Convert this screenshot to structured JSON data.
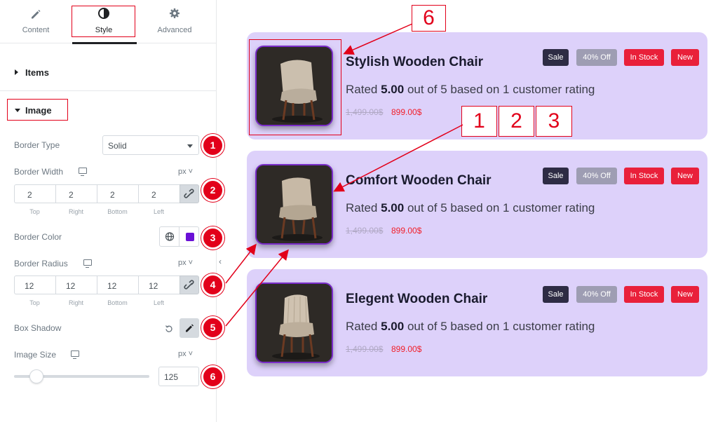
{
  "tabs": [
    {
      "label": "Content",
      "icon": "pencil-icon"
    },
    {
      "label": "Style",
      "icon": "contrast-icon"
    },
    {
      "label": "Advanced",
      "icon": "gear-icon"
    }
  ],
  "sections": {
    "items": "Items",
    "image": "Image"
  },
  "controls": {
    "border_type": {
      "label": "Border Type",
      "value": "Solid"
    },
    "border_width": {
      "label": "Border Width",
      "unit": "px",
      "values": [
        "2",
        "2",
        "2",
        "2"
      ],
      "sides": [
        "Top",
        "Right",
        "Bottom",
        "Left"
      ]
    },
    "border_color": {
      "label": "Border Color",
      "color": "#6a10d6"
    },
    "border_radius": {
      "label": "Border Radius",
      "unit": "px",
      "values": [
        "12",
        "12",
        "12",
        "12"
      ],
      "sides": [
        "Top",
        "Right",
        "Bottom",
        "Left"
      ]
    },
    "box_shadow": {
      "label": "Box Shadow"
    },
    "image_size": {
      "label": "Image Size",
      "unit": "px",
      "value": "125",
      "slider_fraction": 0.12
    }
  },
  "callouts": [
    "1",
    "2",
    "3",
    "4",
    "5",
    "6"
  ],
  "annotations": {
    "top": "6",
    "a": "1",
    "b": "2",
    "c": "3"
  },
  "products": [
    {
      "title": "Stylish Wooden Chair",
      "rating_prefix": "Rated",
      "rating_value": "5.00",
      "rating_suffix": "out of 5 based on 1 customer rating",
      "old_price": "1,499.00$",
      "new_price": "899.00$",
      "tags": [
        "Sale",
        "40% Off",
        "In Stock",
        "New"
      ]
    },
    {
      "title": "Comfort Wooden Chair",
      "rating_prefix": "Rated",
      "rating_value": "5.00",
      "rating_suffix": "out of 5 based on 1 customer rating",
      "old_price": "1,499.00$",
      "new_price": "899.00$",
      "tags": [
        "Sale",
        "40% Off",
        "In Stock",
        "New"
      ]
    },
    {
      "title": "Elegent Wooden Chair",
      "rating_prefix": "Rated",
      "rating_value": "5.00",
      "rating_suffix": "out of 5 based on 1 customer rating",
      "old_price": "1,499.00$",
      "new_price": "899.00$",
      "tags": [
        "Sale",
        "40% Off",
        "In Stock",
        "New"
      ]
    }
  ],
  "colors": {
    "accent_red": "#e2001a",
    "card_bg": "#ddd1fa",
    "image_border": "#7a2cc9"
  }
}
